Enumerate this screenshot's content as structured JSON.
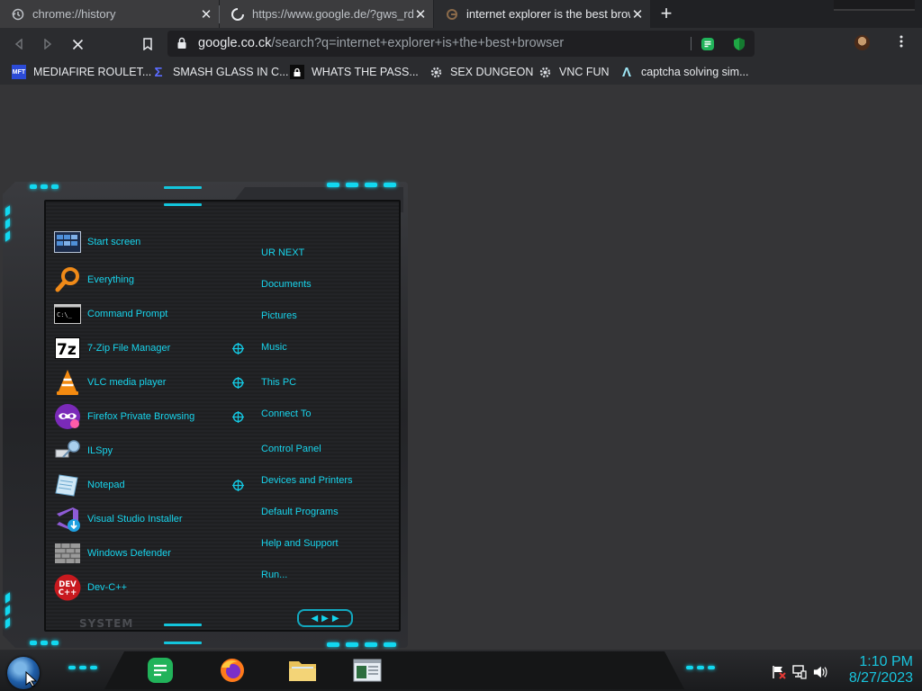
{
  "browser": {
    "tabs": [
      {
        "title": "chrome://history",
        "favicon": "history-icon",
        "state": "inactive"
      },
      {
        "title": "https://www.google.de/?gws_rd=s",
        "favicon": "loading-spinner-icon",
        "state": "inactive"
      },
      {
        "title": "internet explorer is the best brows",
        "favicon": "google-favicon",
        "state": "active"
      }
    ],
    "new_tab_label": "+",
    "address": {
      "host": "google.co.ck",
      "path": "/search?q=internet+explorer+is+the+best+browser"
    },
    "bookmarks": [
      {
        "label": "MEDIAFIRE ROULET...",
        "icon": "mft-icon",
        "icon_text": "MFT"
      },
      {
        "label": "SMASH GLASS IN C...",
        "icon": "sigma-icon",
        "icon_text": "Σ"
      },
      {
        "label": "WHATS THE PASS...",
        "icon": "lock-icon",
        "icon_text": ""
      },
      {
        "label": "SEX DUNGEON",
        "icon": "gear-icon",
        "icon_text": ""
      },
      {
        "label": "VNC FUN",
        "icon": "gear-icon",
        "icon_text": ""
      },
      {
        "label": "captcha solving sim...",
        "icon": "triangle-icon",
        "icon_text": "Λ"
      }
    ]
  },
  "start_menu": {
    "programs": [
      {
        "label": "Start screen",
        "icon": "start-screen-icon"
      },
      {
        "label": "Everything",
        "icon": "magnifier-icon"
      },
      {
        "label": "Command Prompt",
        "icon": "cmd-icon",
        "icon_text": "C:\\_"
      },
      {
        "label": "7-Zip File Manager",
        "icon": "7zip-icon",
        "icon_text": "7z"
      },
      {
        "label": "VLC media player",
        "icon": "vlc-cone-icon"
      },
      {
        "label": "Firefox Private Browsing",
        "icon": "private-mask-icon"
      },
      {
        "label": "ILSpy",
        "icon": "ilspy-icon"
      },
      {
        "label": "Notepad",
        "icon": "notepad-icon"
      },
      {
        "label": "Visual Studio Installer",
        "icon": "vs-installer-icon"
      },
      {
        "label": "Windows Defender",
        "icon": "brick-wall-icon"
      },
      {
        "label": "Dev-C++",
        "icon": "devcpp-icon",
        "icon_text": "DEV C++"
      }
    ],
    "places": [
      "UR NEXT",
      "Documents",
      "Pictures",
      "Music",
      "This PC",
      "Connect To",
      "Control Panel",
      "Devices and Printers",
      "Default Programs",
      "Help and Support",
      "Run..."
    ],
    "system_label": "SYSTEM"
  },
  "taskbar": {
    "apps": [
      {
        "name": "notes-app",
        "icon": "notes-icon"
      },
      {
        "name": "firefox",
        "icon": "firefox-icon"
      },
      {
        "name": "file-explorer",
        "icon": "folder-icon"
      },
      {
        "name": "window-app",
        "icon": "window-icon"
      }
    ],
    "tray": [
      "flag-icon",
      "network-icon",
      "volume-icon"
    ],
    "clock": {
      "time": "1:10 PM",
      "date": "8/27/2023"
    }
  },
  "colors": {
    "accent": "#18d4ec",
    "background": "#353537",
    "chrome": "#2b2c2f"
  }
}
